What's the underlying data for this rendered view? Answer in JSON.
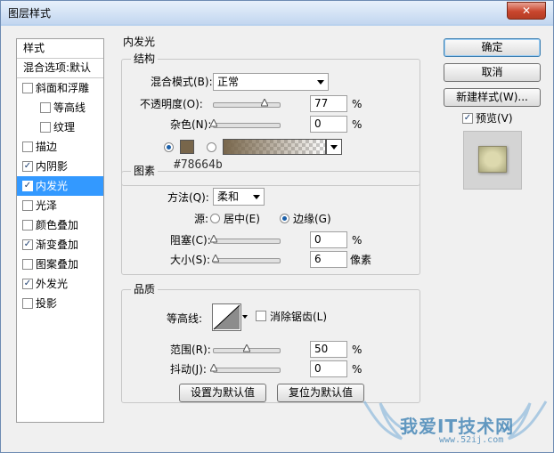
{
  "window": {
    "title": "图层样式",
    "close_symbol": "✕"
  },
  "left_list": {
    "header": "样式",
    "blend_options": "混合选项:默认",
    "items": [
      {
        "label": "斜面和浮雕",
        "checked": false,
        "sub": false
      },
      {
        "label": "等高线",
        "checked": false,
        "sub": true
      },
      {
        "label": "纹理",
        "checked": false,
        "sub": true
      },
      {
        "label": "描边",
        "checked": false,
        "sub": false
      },
      {
        "label": "内阴影",
        "checked": true,
        "sub": false
      },
      {
        "label": "内发光",
        "checked": true,
        "sub": false,
        "selected": true
      },
      {
        "label": "光泽",
        "checked": false,
        "sub": false
      },
      {
        "label": "颜色叠加",
        "checked": false,
        "sub": false
      },
      {
        "label": "渐变叠加",
        "checked": true,
        "sub": false
      },
      {
        "label": "图案叠加",
        "checked": false,
        "sub": false
      },
      {
        "label": "外发光",
        "checked": true,
        "sub": false
      },
      {
        "label": "投影",
        "checked": false,
        "sub": false
      }
    ]
  },
  "inner_glow": {
    "title": "内发光",
    "structure": {
      "title": "结构",
      "blend_mode_label": "混合模式(B):",
      "blend_mode_value": "正常",
      "opacity_label": "不透明度(O):",
      "opacity_value": "77",
      "opacity_percent": 77,
      "noise_label": "杂色(N):",
      "noise_value": "0",
      "noise_percent": 0,
      "percent_sign": "%",
      "color": "#78664b",
      "color_hex_label": "#78664b"
    },
    "elements": {
      "title": "图素",
      "technique_label": "方法(Q):",
      "technique_value": "柔和",
      "source_label": "源:",
      "source_center": "居中(E)",
      "source_edge": "边缘(G)",
      "choke_label": "阻塞(C):",
      "choke_value": "0",
      "choke_percent": 0,
      "size_label": "大小(S):",
      "size_value": "6",
      "size_unit": "像素",
      "size_fraction": 0.024,
      "percent_sign": "%"
    },
    "quality": {
      "title": "品质",
      "contour_label": "等高线:",
      "anti_alias_label": "消除锯齿(L)",
      "range_label": "范围(R):",
      "range_value": "50",
      "range_percent": 50,
      "jitter_label": "抖动(J):",
      "jitter_value": "0",
      "jitter_percent": 0,
      "percent_sign": "%"
    },
    "make_default": "设置为默认值",
    "reset_default": "复位为默认值"
  },
  "right_panel": {
    "ok": "确定",
    "cancel": "取消",
    "new_style": "新建样式(W)...",
    "preview_label": "预览(V)",
    "preview_checked": true
  },
  "watermark": {
    "text": "我爱IT技术网",
    "url": "www.52ij.com"
  }
}
